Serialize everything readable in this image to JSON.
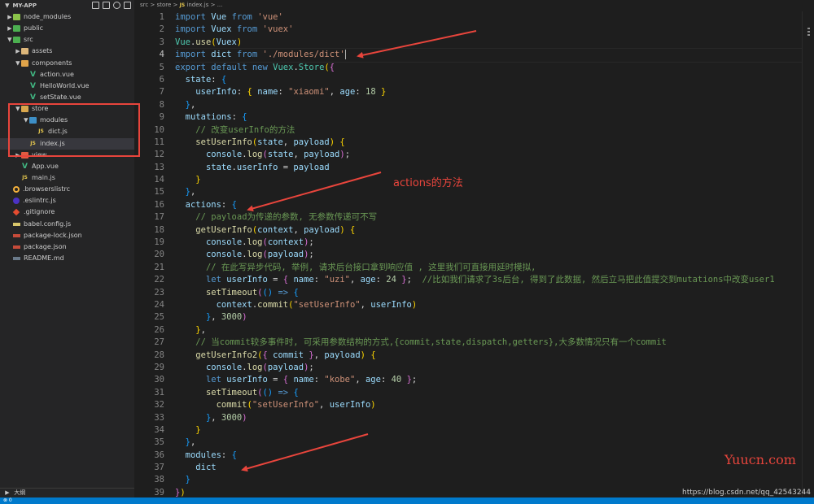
{
  "explorer": {
    "root_label": "MY-APP",
    "outline_label": "大纲",
    "items": [
      {
        "label": "node_modules",
        "depth": 0,
        "kind": "folder",
        "icon": "folder-node-icon",
        "chevron": "right"
      },
      {
        "label": "public",
        "depth": 0,
        "kind": "folder",
        "icon": "folder-public-icon",
        "chevron": "right"
      },
      {
        "label": "src",
        "depth": 0,
        "kind": "folder",
        "icon": "folder-src-icon",
        "chevron": "down"
      },
      {
        "label": "assets",
        "depth": 1,
        "kind": "folder",
        "icon": "folder-icon",
        "chevron": "right"
      },
      {
        "label": "components",
        "depth": 1,
        "kind": "folder",
        "icon": "folder-components-icon",
        "chevron": "down"
      },
      {
        "label": "action.vue",
        "depth": 2,
        "kind": "file",
        "icon": "vue-icon"
      },
      {
        "label": "HelloWorld.vue",
        "depth": 2,
        "kind": "file",
        "icon": "vue-icon"
      },
      {
        "label": "setState.vue",
        "depth": 2,
        "kind": "file",
        "icon": "vue-icon"
      },
      {
        "label": "store",
        "depth": 1,
        "kind": "folder",
        "icon": "folder-store-icon",
        "chevron": "down"
      },
      {
        "label": "modules",
        "depth": 2,
        "kind": "folder",
        "icon": "folder-modules-icon",
        "chevron": "down"
      },
      {
        "label": "dict.js",
        "depth": 3,
        "kind": "file",
        "icon": "js-icon"
      },
      {
        "label": "index.js",
        "depth": 2,
        "kind": "file",
        "icon": "js-icon",
        "selected": true
      },
      {
        "label": "view",
        "depth": 1,
        "kind": "folder",
        "icon": "folder-view-icon",
        "chevron": "right"
      },
      {
        "label": "App.vue",
        "depth": 1,
        "kind": "file",
        "icon": "vue-icon"
      },
      {
        "label": "main.js",
        "depth": 1,
        "kind": "file",
        "icon": "js-icon"
      },
      {
        "label": ".browserslistrc",
        "depth": 0,
        "kind": "file",
        "icon": "browserslist-icon"
      },
      {
        "label": ".eslintrc.js",
        "depth": 0,
        "kind": "file",
        "icon": "eslint-icon"
      },
      {
        "label": ".gitignore",
        "depth": 0,
        "kind": "file",
        "icon": "git-icon"
      },
      {
        "label": "babel.config.js",
        "depth": 0,
        "kind": "file",
        "icon": "babel-icon"
      },
      {
        "label": "package-lock.json",
        "depth": 0,
        "kind": "file",
        "icon": "json-icon"
      },
      {
        "label": "package.json",
        "depth": 0,
        "kind": "file",
        "icon": "json-icon"
      },
      {
        "label": "README.md",
        "depth": 0,
        "kind": "file",
        "icon": "markdown-icon"
      }
    ]
  },
  "breadcrumb": {
    "part1": "src",
    "part2": "store",
    "file_badge": "JS",
    "part3": "index.js",
    "part4": "..."
  },
  "editor": {
    "active_line": 4,
    "lines": [
      [
        [
          "k",
          "import"
        ],
        [
          "o",
          " "
        ],
        [
          "v",
          "Vue"
        ],
        [
          "o",
          " "
        ],
        [
          "k",
          "from"
        ],
        [
          "o",
          " "
        ],
        [
          "s",
          "'vue'"
        ]
      ],
      [
        [
          "k",
          "import"
        ],
        [
          "o",
          " "
        ],
        [
          "v",
          "Vuex"
        ],
        [
          "o",
          " "
        ],
        [
          "k",
          "from"
        ],
        [
          "o",
          " "
        ],
        [
          "s",
          "'vuex'"
        ]
      ],
      [
        [
          "t",
          "Vue"
        ],
        [
          "o",
          "."
        ],
        [
          "f",
          "use"
        ],
        [
          "b",
          "("
        ],
        [
          "v",
          "Vuex"
        ],
        [
          "b",
          ")"
        ]
      ],
      [
        [
          "k",
          "import"
        ],
        [
          "o",
          " "
        ],
        [
          "v",
          "dict"
        ],
        [
          "o",
          " "
        ],
        [
          "k",
          "from"
        ],
        [
          "o",
          " "
        ],
        [
          "s",
          "'./modules/dict'"
        ]
      ],
      [
        [
          "k",
          "export"
        ],
        [
          "o",
          " "
        ],
        [
          "k",
          "default"
        ],
        [
          "o",
          " "
        ],
        [
          "k",
          "new"
        ],
        [
          "o",
          " "
        ],
        [
          "t",
          "Vuex"
        ],
        [
          "o",
          "."
        ],
        [
          "t",
          "Store"
        ],
        [
          "b",
          "("
        ],
        [
          "b2",
          "{"
        ]
      ],
      [
        [
          "o",
          "  "
        ],
        [
          "p",
          "state"
        ],
        [
          "o",
          ": "
        ],
        [
          "b3",
          "{"
        ]
      ],
      [
        [
          "o",
          "    "
        ],
        [
          "p",
          "userInfo"
        ],
        [
          "o",
          ": "
        ],
        [
          "b",
          "{"
        ],
        [
          "o",
          " "
        ],
        [
          "p",
          "name"
        ],
        [
          "o",
          ": "
        ],
        [
          "s",
          "\"xiaomi\""
        ],
        [
          "o",
          ", "
        ],
        [
          "p",
          "age"
        ],
        [
          "o",
          ": "
        ],
        [
          "n",
          "18"
        ],
        [
          "o",
          " "
        ],
        [
          "b",
          "}"
        ]
      ],
      [
        [
          "o",
          "  "
        ],
        [
          "b3",
          "}"
        ],
        [
          "o",
          ","
        ]
      ],
      [
        [
          "o",
          "  "
        ],
        [
          "p",
          "mutations"
        ],
        [
          "o",
          ": "
        ],
        [
          "b3",
          "{"
        ]
      ],
      [
        [
          "o",
          "    "
        ],
        [
          "m",
          "// 改变userInfo的方法"
        ]
      ],
      [
        [
          "o",
          "    "
        ],
        [
          "f",
          "setUserInfo"
        ],
        [
          "b",
          "("
        ],
        [
          "v",
          "state"
        ],
        [
          "o",
          ", "
        ],
        [
          "v",
          "payload"
        ],
        [
          "b",
          ")"
        ],
        [
          "o",
          " "
        ],
        [
          "b",
          "{"
        ]
      ],
      [
        [
          "o",
          "      "
        ],
        [
          "v",
          "console"
        ],
        [
          "o",
          "."
        ],
        [
          "f",
          "log"
        ],
        [
          "b2",
          "("
        ],
        [
          "v",
          "state"
        ],
        [
          "o",
          ", "
        ],
        [
          "v",
          "payload"
        ],
        [
          "b2",
          ")"
        ],
        [
          "o",
          ";"
        ]
      ],
      [
        [
          "o",
          "      "
        ],
        [
          "v",
          "state"
        ],
        [
          "o",
          "."
        ],
        [
          "v",
          "userInfo"
        ],
        [
          "o",
          " = "
        ],
        [
          "v",
          "payload"
        ]
      ],
      [
        [
          "o",
          "    "
        ],
        [
          "b",
          "}"
        ]
      ],
      [
        [
          "o",
          "  "
        ],
        [
          "b3",
          "}"
        ],
        [
          "o",
          ","
        ]
      ],
      [
        [
          "o",
          "  "
        ],
        [
          "p",
          "actions"
        ],
        [
          "o",
          ": "
        ],
        [
          "b3",
          "{"
        ]
      ],
      [
        [
          "o",
          "    "
        ],
        [
          "m",
          "// payload为传递的参数, 无参数传递可不写"
        ]
      ],
      [
        [
          "o",
          "    "
        ],
        [
          "f",
          "getUserInfo"
        ],
        [
          "b",
          "("
        ],
        [
          "v",
          "context"
        ],
        [
          "o",
          ", "
        ],
        [
          "v",
          "payload"
        ],
        [
          "b",
          ")"
        ],
        [
          "o",
          " "
        ],
        [
          "b",
          "{"
        ]
      ],
      [
        [
          "o",
          "      "
        ],
        [
          "v",
          "console"
        ],
        [
          "o",
          "."
        ],
        [
          "f",
          "log"
        ],
        [
          "b2",
          "("
        ],
        [
          "v",
          "context"
        ],
        [
          "b2",
          ")"
        ],
        [
          "o",
          ";"
        ]
      ],
      [
        [
          "o",
          "      "
        ],
        [
          "v",
          "console"
        ],
        [
          "o",
          "."
        ],
        [
          "f",
          "log"
        ],
        [
          "b2",
          "("
        ],
        [
          "v",
          "payload"
        ],
        [
          "b2",
          ")"
        ],
        [
          "o",
          ";"
        ]
      ],
      [
        [
          "o",
          "      "
        ],
        [
          "m",
          "// 在此写异步代码, 举例, 请求后台接口拿到响应值 , 这里我们可直接用延时模拟,"
        ]
      ],
      [
        [
          "o",
          "      "
        ],
        [
          "k",
          "let"
        ],
        [
          "o",
          " "
        ],
        [
          "v",
          "userInfo"
        ],
        [
          "o",
          " = "
        ],
        [
          "b2",
          "{"
        ],
        [
          "o",
          " "
        ],
        [
          "p",
          "name"
        ],
        [
          "o",
          ": "
        ],
        [
          "s",
          "\"uzi\""
        ],
        [
          "o",
          ", "
        ],
        [
          "p",
          "age"
        ],
        [
          "o",
          ": "
        ],
        [
          "n",
          "24"
        ],
        [
          "o",
          " "
        ],
        [
          "b2",
          "}"
        ],
        [
          "o",
          ";  "
        ],
        [
          "m",
          "//比如我们请求了3s后台, 得到了此数据, 然后立马把此值提交到mutations中改变user1"
        ]
      ],
      [
        [
          "o",
          "      "
        ],
        [
          "f",
          "setTimeout"
        ],
        [
          "b2",
          "("
        ],
        [
          "b3",
          "()"
        ],
        [
          "o",
          " "
        ],
        [
          "k",
          "=>"
        ],
        [
          "o",
          " "
        ],
        [
          "b3",
          "{"
        ]
      ],
      [
        [
          "o",
          "        "
        ],
        [
          "v",
          "context"
        ],
        [
          "o",
          "."
        ],
        [
          "f",
          "commit"
        ],
        [
          "b",
          "("
        ],
        [
          "s",
          "\"setUserInfo\""
        ],
        [
          "o",
          ", "
        ],
        [
          "v",
          "userInfo"
        ],
        [
          "b",
          ")"
        ]
      ],
      [
        [
          "o",
          "      "
        ],
        [
          "b3",
          "}"
        ],
        [
          "o",
          ", "
        ],
        [
          "n",
          "3000"
        ],
        [
          "b2",
          ")"
        ]
      ],
      [
        [
          "o",
          "    "
        ],
        [
          "b",
          "}"
        ],
        [
          "o",
          ","
        ]
      ],
      [
        [
          "o",
          "    "
        ],
        [
          "m",
          "// 当commit较多事件时, 可采用参数结构的方式,{commit,state,dispatch,getters},大多数情况只有一个commit"
        ]
      ],
      [
        [
          "o",
          "    "
        ],
        [
          "f",
          "getUserInfo2"
        ],
        [
          "b",
          "("
        ],
        [
          "b2",
          "{"
        ],
        [
          "o",
          " "
        ],
        [
          "v",
          "commit"
        ],
        [
          "o",
          " "
        ],
        [
          "b2",
          "}"
        ],
        [
          "o",
          ", "
        ],
        [
          "v",
          "payload"
        ],
        [
          "b",
          ")"
        ],
        [
          "o",
          " "
        ],
        [
          "b",
          "{"
        ]
      ],
      [
        [
          "o",
          "      "
        ],
        [
          "v",
          "console"
        ],
        [
          "o",
          "."
        ],
        [
          "f",
          "log"
        ],
        [
          "b2",
          "("
        ],
        [
          "v",
          "payload"
        ],
        [
          "b2",
          ")"
        ],
        [
          "o",
          ";"
        ]
      ],
      [
        [
          "o",
          "      "
        ],
        [
          "k",
          "let"
        ],
        [
          "o",
          " "
        ],
        [
          "v",
          "userInfo"
        ],
        [
          "o",
          " = "
        ],
        [
          "b2",
          "{"
        ],
        [
          "o",
          " "
        ],
        [
          "p",
          "name"
        ],
        [
          "o",
          ": "
        ],
        [
          "s",
          "\"kobe\""
        ],
        [
          "o",
          ", "
        ],
        [
          "p",
          "age"
        ],
        [
          "o",
          ": "
        ],
        [
          "n",
          "40"
        ],
        [
          "o",
          " "
        ],
        [
          "b2",
          "}"
        ],
        [
          "o",
          ";"
        ]
      ],
      [
        [
          "o",
          "      "
        ],
        [
          "f",
          "setTimeout"
        ],
        [
          "b2",
          "("
        ],
        [
          "b3",
          "()"
        ],
        [
          "o",
          " "
        ],
        [
          "k",
          "=>"
        ],
        [
          "o",
          " "
        ],
        [
          "b3",
          "{"
        ]
      ],
      [
        [
          "o",
          "        "
        ],
        [
          "f",
          "commit"
        ],
        [
          "b",
          "("
        ],
        [
          "s",
          "\"setUserInfo\""
        ],
        [
          "o",
          ", "
        ],
        [
          "v",
          "userInfo"
        ],
        [
          "b",
          ")"
        ]
      ],
      [
        [
          "o",
          "      "
        ],
        [
          "b3",
          "}"
        ],
        [
          "o",
          ", "
        ],
        [
          "n",
          "3000"
        ],
        [
          "b2",
          ")"
        ]
      ],
      [
        [
          "o",
          "    "
        ],
        [
          "b",
          "}"
        ]
      ],
      [
        [
          "o",
          "  "
        ],
        [
          "b3",
          "}"
        ],
        [
          "o",
          ","
        ]
      ],
      [
        [
          "o",
          "  "
        ],
        [
          "p",
          "modules"
        ],
        [
          "o",
          ": "
        ],
        [
          "b3",
          "{"
        ]
      ],
      [
        [
          "o",
          "    "
        ],
        [
          "v",
          "dict"
        ]
      ],
      [
        [
          "o",
          "  "
        ],
        [
          "b3",
          "}"
        ]
      ],
      [
        [
          "b2",
          "}"
        ],
        [
          "b",
          ")"
        ]
      ]
    ]
  },
  "annotations": {
    "actions_note": "actions的方法",
    "watermark": "Yuucn.com",
    "source_url": "https://blog.csdn.net/qq_42543244"
  },
  "colors": {
    "annotation_red": "#e8453c",
    "status_bar": "#007acc",
    "editor_bg": "#1e1e1e",
    "sidebar_bg": "#252526"
  }
}
